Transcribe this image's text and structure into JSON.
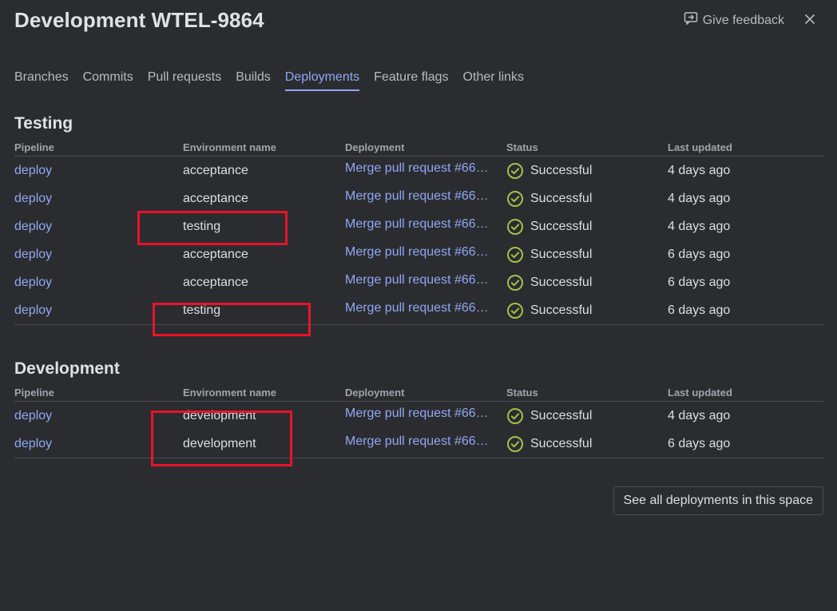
{
  "header": {
    "title": "Development WTEL-9864",
    "feedback_label": "Give feedback"
  },
  "tabs": [
    {
      "label": "Branches"
    },
    {
      "label": "Commits"
    },
    {
      "label": "Pull requests"
    },
    {
      "label": "Builds"
    },
    {
      "label": "Deployments",
      "active": true
    },
    {
      "label": "Feature flags"
    },
    {
      "label": "Other links"
    }
  ],
  "columns": {
    "pipeline": "Pipeline",
    "environment": "Environment name",
    "deployment": "Deployment",
    "status": "Status",
    "updated": "Last updated"
  },
  "testing": {
    "title": "Testing",
    "rows": [
      {
        "pipeline": "deploy",
        "environment": "acceptance",
        "deployment": "Merge pull request #66…",
        "status": "Successful",
        "updated": "4 days ago"
      },
      {
        "pipeline": "deploy",
        "environment": "acceptance",
        "deployment": "Merge pull request #66…",
        "status": "Successful",
        "updated": "4 days ago"
      },
      {
        "pipeline": "deploy",
        "environment": "testing",
        "deployment": "Merge pull request #66…",
        "status": "Successful",
        "updated": "4 days ago"
      },
      {
        "pipeline": "deploy",
        "environment": "acceptance",
        "deployment": "Merge pull request #66…",
        "status": "Successful",
        "updated": "6 days ago"
      },
      {
        "pipeline": "deploy",
        "environment": "acceptance",
        "deployment": "Merge pull request #66…",
        "status": "Successful",
        "updated": "6 days ago"
      },
      {
        "pipeline": "deploy",
        "environment": "testing",
        "deployment": "Merge pull request #66…",
        "status": "Successful",
        "updated": "6 days ago"
      }
    ]
  },
  "development": {
    "title": "Development",
    "rows": [
      {
        "pipeline": "deploy",
        "environment": "development",
        "deployment": "Merge pull request #66…",
        "status": "Successful",
        "updated": "4 days ago"
      },
      {
        "pipeline": "deploy",
        "environment": "development",
        "deployment": "Merge pull request #66…",
        "status": "Successful",
        "updated": "6 days ago"
      }
    ]
  },
  "see_all_label": "See all deployments in this space",
  "colors": {
    "background": "#2b2c2f",
    "link": "#8fa8f5",
    "success": "#a3c14a",
    "highlight": "#e8132a"
  },
  "icons": {
    "feedback": "feedback-icon",
    "close": "close-icon",
    "status": "check-circle-icon"
  }
}
